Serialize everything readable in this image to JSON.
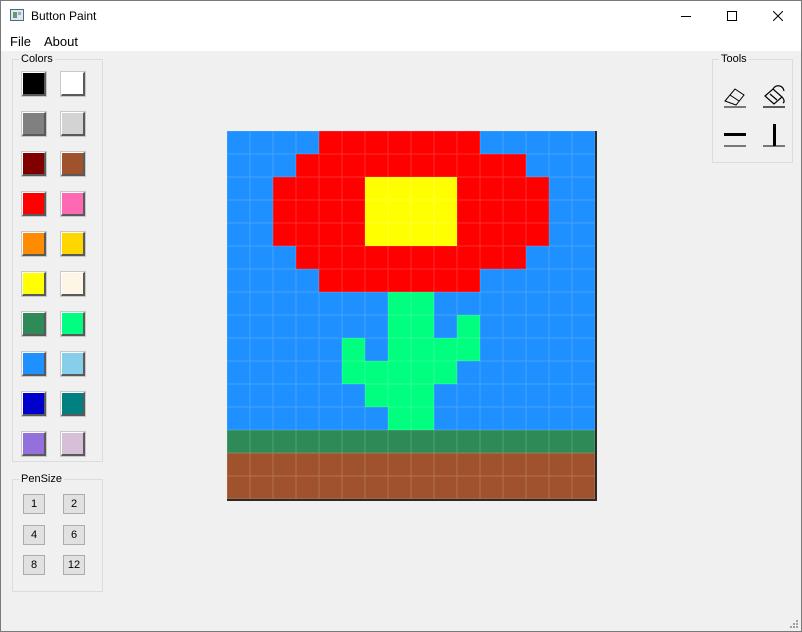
{
  "window": {
    "title": "Button Paint"
  },
  "menu": [
    "File",
    "About"
  ],
  "colors_group": {
    "title": "Colors",
    "swatches": [
      "#000000",
      "#ffffff",
      "#808080",
      "#d3d3d3",
      "#800000",
      "#a0522d",
      "#ff0000",
      "#ff69b4",
      "#ff8c00",
      "#ffd700",
      "#ffff00",
      "#fdf5e6",
      "#2e8b57",
      "#00ff7f",
      "#1e90ff",
      "#87ceeb",
      "#0000cd",
      "#008080",
      "#9370db",
      "#d8bfd8"
    ]
  },
  "pensize_group": {
    "title": "PenSize",
    "sizes": [
      "1",
      "2",
      "4",
      "6",
      "8",
      "12"
    ]
  },
  "tools_group": {
    "title": "Tools",
    "tools": [
      "eraser-icon",
      "fill-bucket-icon",
      "horizontal-line-icon",
      "vertical-line-icon"
    ]
  },
  "canvas": {
    "palette": {
      "B": "#1e90ff",
      "R": "#ff0000",
      "Y": "#ffff00",
      "G": "#00ff7f",
      "D": "#2e8b57",
      "N": "#a0522d"
    },
    "rows": [
      "BBBBRRRRRRRBBBBB",
      "BBBRRRRRRRRRRBBB",
      "BBRRRRYYYYRRRRBB",
      "BBRRRRYYYYRRRRBB",
      "BBRRRRYYYYRRRRBB",
      "BBBRRRRRRRRRRBBB",
      "BBBBRRRRRRRBBBBB",
      "BBBBBBBGGBBBBBBB",
      "BBBBBBBGGBGBBBBB",
      "BBBBBGBGGGGBBBBB",
      "BBBBBGGGGGBBBBBB",
      "BBBBBBGGGBBBBBBB",
      "BBBBBBBGGBBBBBBB",
      "DDDDDDDDDDDDDDDD",
      "NNNNNNNNNNNNNNNN",
      "NNNNNNNNNNNNNNNN"
    ]
  }
}
